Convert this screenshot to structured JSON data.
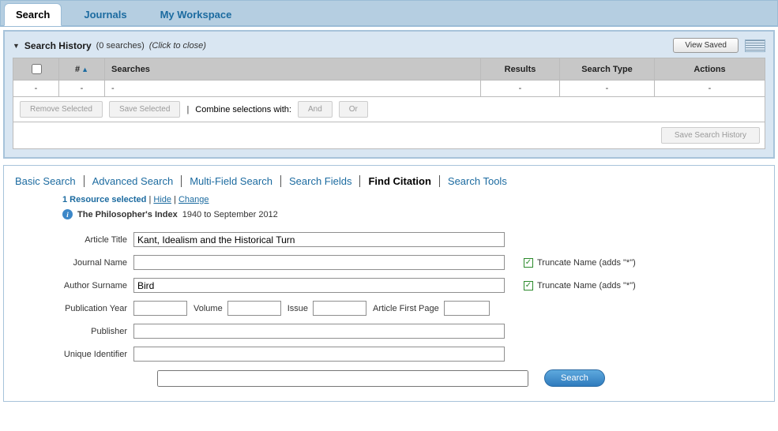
{
  "tabs": {
    "search": "Search",
    "journals": "Journals",
    "workspace": "My Workspace"
  },
  "history": {
    "title": "Search History",
    "count": "(0 searches)",
    "hint": "(Click to close)",
    "view_saved": "View Saved",
    "cols": {
      "num": "#",
      "searches": "Searches",
      "results": "Results",
      "type": "Search Type",
      "actions": "Actions"
    },
    "empty": "-",
    "remove": "Remove Selected",
    "save_sel": "Save Selected",
    "combine": "Combine selections with:",
    "and": "And",
    "or": "Or",
    "save_hist": "Save Search History"
  },
  "subtabs": {
    "basic": "Basic Search",
    "adv": "Advanced Search",
    "multi": "Multi-Field Search",
    "fields": "Search Fields",
    "find": "Find Citation",
    "tools": "Search Tools"
  },
  "resource": {
    "selected": "1 Resource selected",
    "hide": "Hide",
    "change": "Change",
    "db_name": "The Philosopher's Index",
    "db_range": "1940 to September 2012"
  },
  "form": {
    "article_title_lbl": "Article Title",
    "article_title_val": "Kant, Idealism and the Historical Turn",
    "journal_lbl": "Journal Name",
    "journal_val": "",
    "author_lbl": "Author Surname",
    "author_val": "Bird",
    "pubyear_lbl": "Publication Year",
    "volume_lbl": "Volume",
    "issue_lbl": "Issue",
    "firstpage_lbl": "Article First Page",
    "publisher_lbl": "Publisher",
    "uid_lbl": "Unique Identifier",
    "truncate": "Truncate Name (adds \"*\")",
    "search_btn": "Search"
  }
}
